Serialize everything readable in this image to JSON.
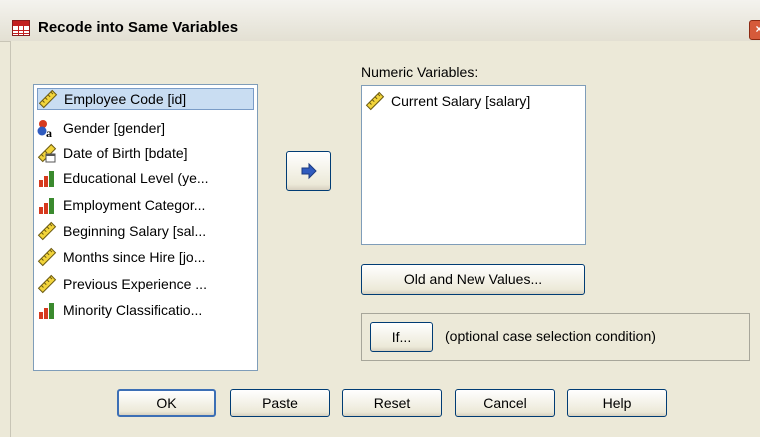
{
  "window": {
    "title": "Recode into Same Variables",
    "close_glyph": "×"
  },
  "source_list": {
    "items": [
      {
        "label": "Employee Code [id]",
        "icon": "ruler-icon",
        "selected": true
      },
      {
        "label": "Gender [gender]",
        "icon": "nominal-string-icon",
        "selected": false
      },
      {
        "label": "Date of Birth [bdate]",
        "icon": "date-ruler-icon",
        "selected": false
      },
      {
        "label": "Educational Level (ye...",
        "icon": "ordinal-bars-icon",
        "selected": false
      },
      {
        "label": "Employment Categor...",
        "icon": "ordinal-bars-icon",
        "selected": false
      },
      {
        "label": "Beginning Salary [sal...",
        "icon": "ruler-icon",
        "selected": false
      },
      {
        "label": "Months since Hire [jo...",
        "icon": "ruler-icon",
        "selected": false
      },
      {
        "label": "Previous Experience ...",
        "icon": "ruler-icon",
        "selected": false
      },
      {
        "label": "Minority Classificatio...",
        "icon": "ordinal-bars-icon",
        "selected": false
      }
    ]
  },
  "target": {
    "label": "Numeric Variables:",
    "mnemonic": "V",
    "items": [
      {
        "label": "Current Salary [salary]",
        "icon": "ruler-icon"
      }
    ]
  },
  "buttons": {
    "old_new": "Old and New Values...",
    "if": "If...",
    "ok": "OK",
    "paste": "Paste",
    "reset": "Reset",
    "cancel": "Cancel",
    "help": "Help"
  },
  "if_group": {
    "caption": "(optional case selection condition)"
  },
  "colors": {
    "dialog_bg": "#ece9d8",
    "selection_bg": "#c9ddf2",
    "arrow_blue": "#2f5bbf",
    "ruler_yellow": "#f2d43a",
    "bar_red": "#d63a1e",
    "bar_green": "#3a8a2e"
  }
}
